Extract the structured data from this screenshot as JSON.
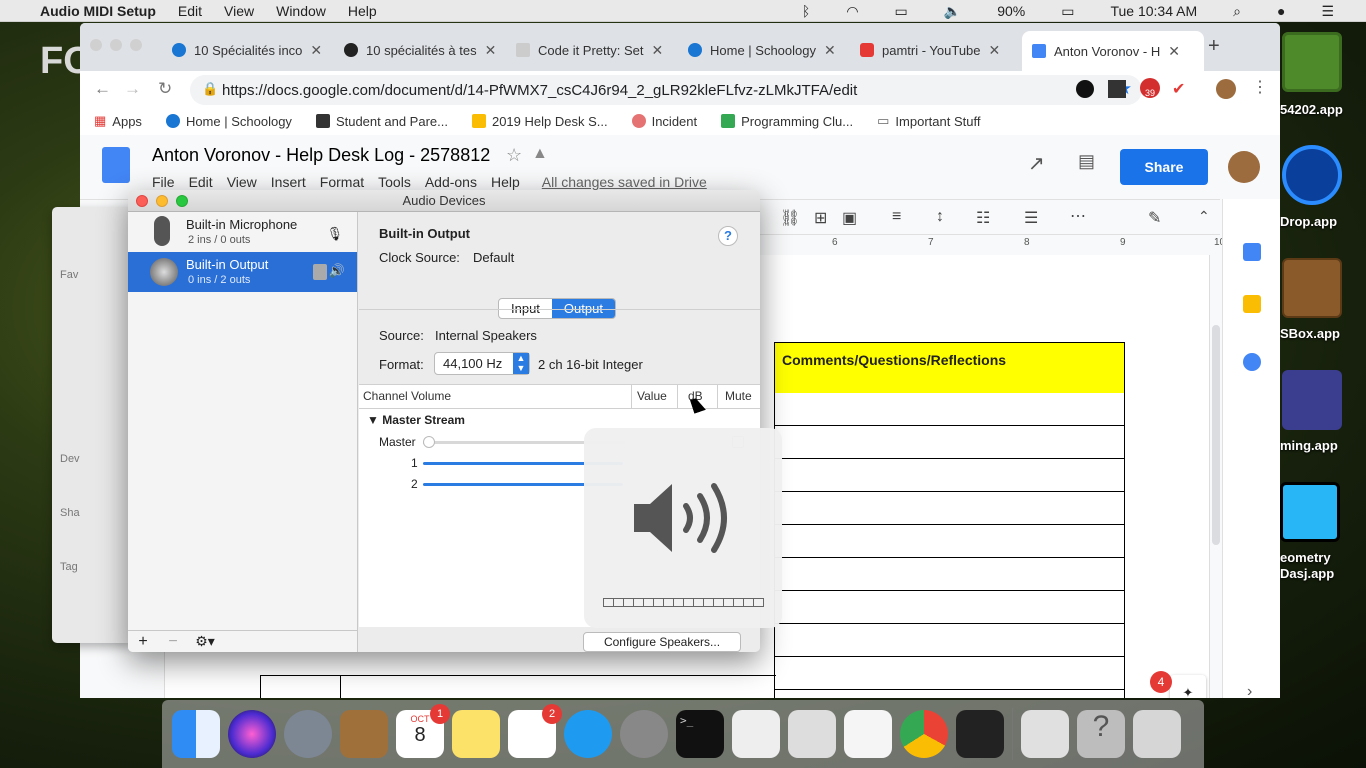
{
  "menubar": {
    "app": "Audio MIDI Setup",
    "items": [
      "Edit",
      "View",
      "Window",
      "Help"
    ],
    "battery": "90%",
    "clock": "Tue 10:34 AM"
  },
  "desktop": {
    "items": [
      "54202.app",
      "Drop.app",
      "SBox.app",
      "ming.app",
      "eometry",
      "Dasj.app"
    ]
  },
  "browser": {
    "tabs": [
      "10 Spécialités inco",
      "10 spécialités à tes",
      "Code it Pretty: Set",
      "Home | Schoology",
      "pamtri - YouTube",
      "Anton Voronov - H"
    ],
    "url": "https://docs.google.com/document/d/14-PfWMX7_csC4J6r94_2_gLR92kleFLfvz-zLMkJTFA/edit",
    "ext_badge": "39",
    "bookmarks": [
      "Apps",
      "Home | Schoology",
      "Student and Pare...",
      "2019 Help Desk S...",
      "Incident",
      "Programming Clu...",
      "Important Stuff"
    ]
  },
  "docs": {
    "title": "Anton Voronov - Help Desk Log - 2578812",
    "menu": [
      "File",
      "Edit",
      "View",
      "Insert",
      "Format",
      "Tools",
      "Add-ons",
      "Help"
    ],
    "saved": "All changes saved in Drive",
    "share": "Share",
    "table_header": "Comments/Questions/Reflections",
    "ruler": [
      "6",
      "7",
      "8",
      "9",
      "10"
    ],
    "notif": "4",
    "left_panel": [
      "Fav",
      "Dev",
      "Sha",
      "Tag"
    ]
  },
  "audio": {
    "window_title": "Audio Devices",
    "devices": [
      {
        "name": "Built-in Microphone",
        "io": "2 ins / 0 outs"
      },
      {
        "name": "Built-in Output",
        "io": "0 ins / 2 outs"
      }
    ],
    "device_title": "Built-in Output",
    "clock_label": "Clock Source:",
    "clock_value": "Default",
    "seg": [
      "Input",
      "Output"
    ],
    "source_label": "Source:",
    "source_value": "Internal Speakers",
    "format_label": "Format:",
    "format_rate": "44,100 Hz",
    "format_desc": "2 ch 16-bit Integer",
    "cols": [
      "Channel Volume",
      "Value",
      "dB",
      "Mute"
    ],
    "stream": "Master Stream",
    "rows": [
      "Master",
      "1",
      "2"
    ],
    "configure": "Configure Speakers...",
    "help": "?"
  },
  "volume_hud": {
    "level": 0
  },
  "dock": {
    "calendar_month": "OCT",
    "calendar_day": "8",
    "cal_badge": "1",
    "reminders_badge": "2"
  }
}
